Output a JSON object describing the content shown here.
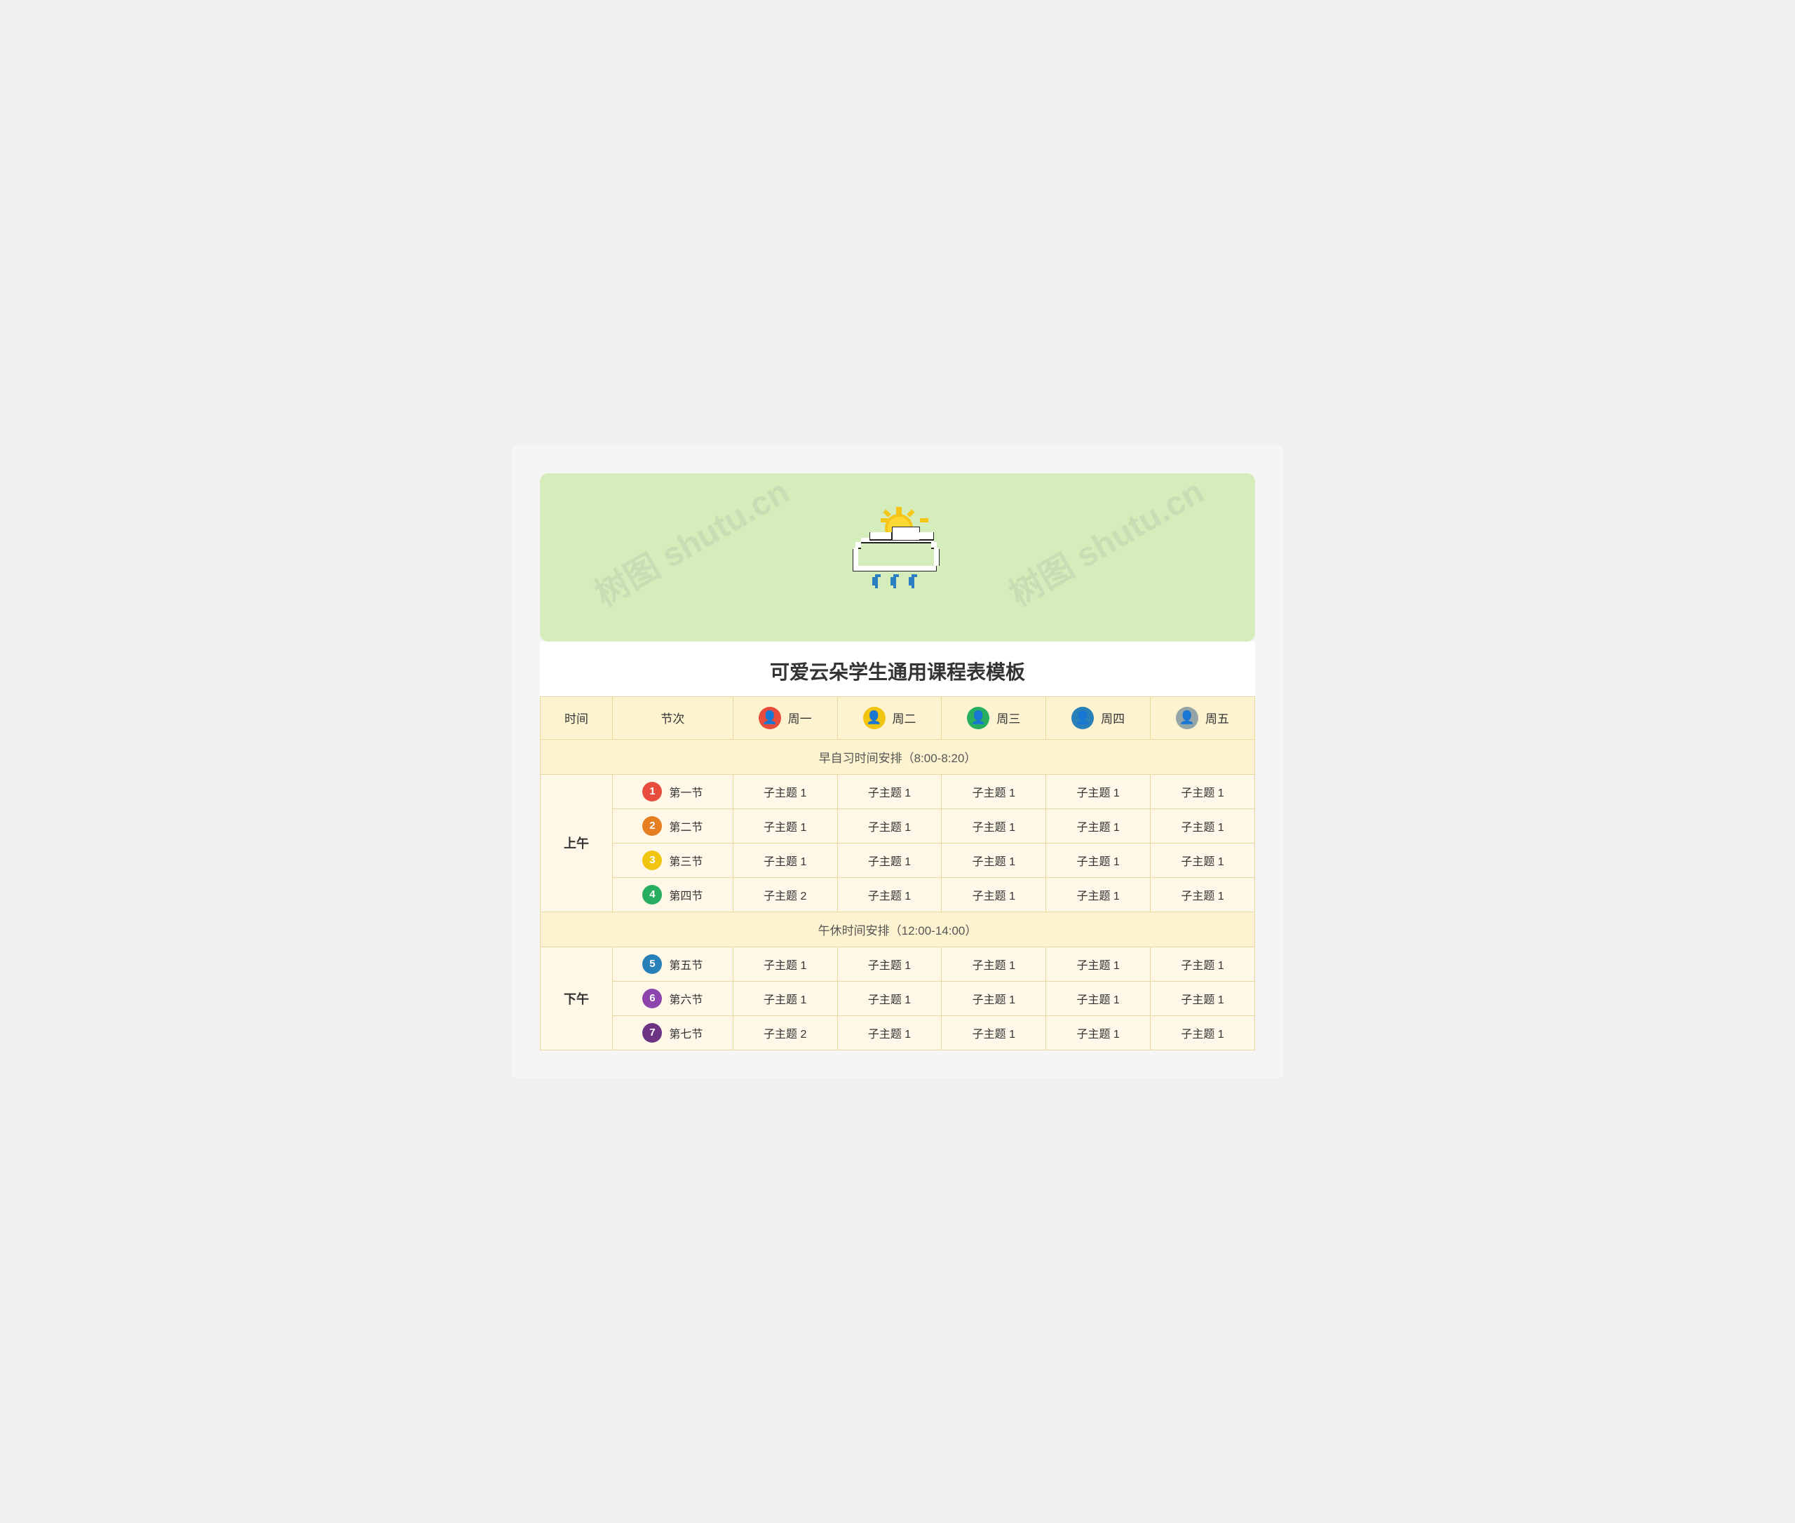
{
  "header": {
    "watermark": "树图 shutu.cn"
  },
  "title": "可爱云朵学生通用课程表模板",
  "table": {
    "headers": {
      "time": "时间",
      "period": "节次",
      "days": [
        {
          "label": "周一",
          "avatar_color": "red"
        },
        {
          "label": "周二",
          "avatar_color": "yellow"
        },
        {
          "label": "周三",
          "avatar_color": "green"
        },
        {
          "label": "周四",
          "avatar_color": "blue"
        },
        {
          "label": "周五",
          "avatar_color": "gray"
        }
      ]
    },
    "morning_break": "早自习时间安排（8:00-8:20）",
    "afternoon_break": "午休时间安排（12:00-14:00）",
    "am_label": "上午",
    "pm_label": "下午",
    "periods": [
      {
        "id": 1,
        "name": "第一节",
        "badge_class": "badge-red",
        "subjects": [
          "子主题 1",
          "子主题 1",
          "子主题 1",
          "子主题 1",
          "子主题 1"
        ]
      },
      {
        "id": 2,
        "name": "第二节",
        "badge_class": "badge-orange",
        "subjects": [
          "子主题 1",
          "子主题 1",
          "子主题 1",
          "子主题 1",
          "子主题 1"
        ]
      },
      {
        "id": 3,
        "name": "第三节",
        "badge_class": "badge-yellow",
        "subjects": [
          "子主题 1",
          "子主题 1",
          "子主题 1",
          "子主题 1",
          "子主题 1"
        ]
      },
      {
        "id": 4,
        "name": "第四节",
        "badge_class": "badge-green",
        "subjects": [
          "子主题 2",
          "子主题 1",
          "子主题 1",
          "子主题 1",
          "子主题 1"
        ]
      },
      {
        "id": 5,
        "name": "第五节",
        "badge_class": "badge-blue",
        "subjects": [
          "子主题 1",
          "子主题 1",
          "子主题 1",
          "子主题 1",
          "子主题 1"
        ]
      },
      {
        "id": 6,
        "name": "第六节",
        "badge_class": "badge-purple-light",
        "subjects": [
          "子主题 1",
          "子主题 1",
          "子主题 1",
          "子主题 1",
          "子主题 1"
        ]
      },
      {
        "id": 7,
        "name": "第七节",
        "badge_class": "badge-purple-dark",
        "subjects": [
          "子主题 2",
          "子主题 1",
          "子主题 1",
          "子主题 1",
          "子主题 1"
        ]
      }
    ]
  }
}
